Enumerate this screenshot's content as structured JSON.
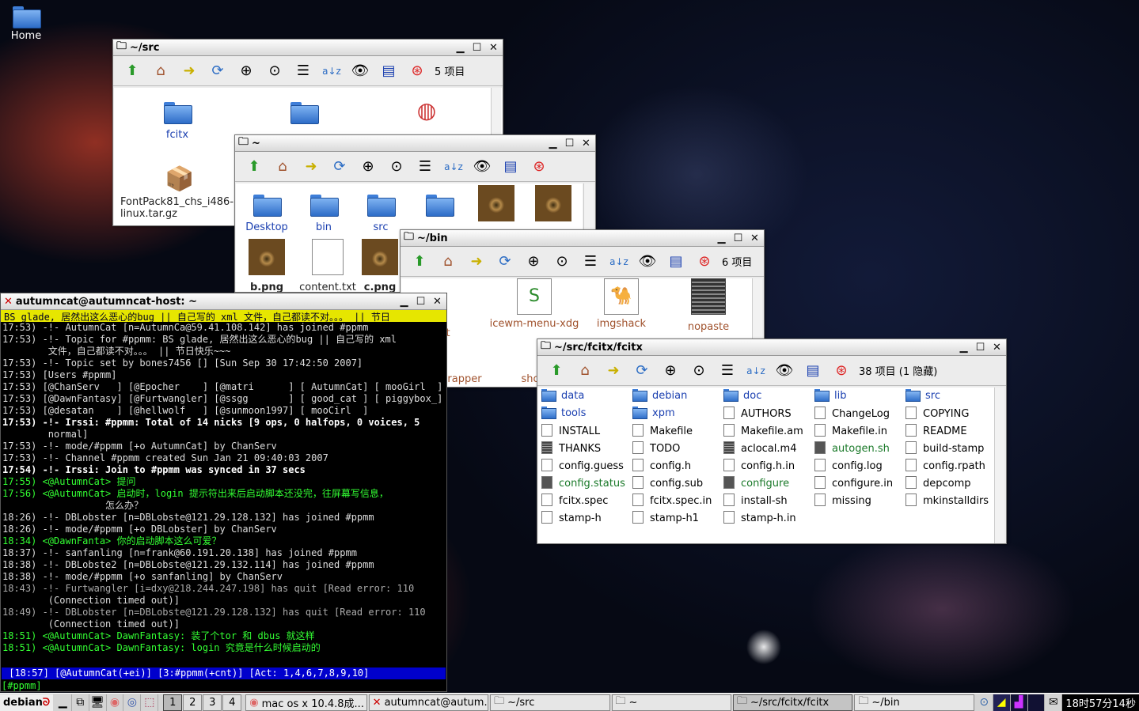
{
  "desktop": {
    "home_label": "Home"
  },
  "win_src": {
    "title": "~/src",
    "count": "5 项目",
    "items": [
      "fcitx",
      "FontPack81_chs_i486-linux.tar.gz"
    ]
  },
  "win_home": {
    "title": "~",
    "items": [
      "Desktop",
      "bin",
      "src",
      "b.png",
      "content.txt",
      "c.png"
    ]
  },
  "win_bin": {
    "title": "~/bin",
    "count": "6 项目",
    "items": [
      "Get",
      "icewm-menu-xdg",
      "imgshack",
      "nopaste",
      "rapper",
      "sho"
    ]
  },
  "win_fcitx": {
    "title": "~/src/fcitx/fcitx",
    "count": "38 项目 (1 隐藏)",
    "files": [
      "data",
      "debian",
      "doc",
      "lib",
      "src",
      "tools",
      "xpm",
      "AUTHORS",
      "ChangeLog",
      "COPYING",
      "INSTALL",
      "Makefile",
      "Makefile.am",
      "Makefile.in",
      "README",
      "THANKS",
      "TODO",
      "aclocal.m4",
      "autogen.sh",
      "build-stamp",
      "config.guess",
      "config.h",
      "config.h.in",
      "config.log",
      "config.rpath",
      "config.status",
      "config.sub",
      "configure",
      "configure.in",
      "depcomp",
      "fcitx.spec",
      "fcitx.spec.in",
      "install-sh",
      "missing",
      "mkinstalldirs",
      "stamp-h",
      "stamp-h1",
      "stamp-h.in"
    ]
  },
  "terminal": {
    "title": "autumncat@autumncat-host: ~",
    "topic": "BS glade, 居然出这么恶心的bug || 自己写的 xml 文件，自己都读不对。。。 || 节日",
    "lines": [
      "17:53) -!- AutumnCat [n=AutumnCa@59.41.108.142] has joined #ppmm",
      "17:53) -!- Topic for #ppmm: BS glade, 居然出这么恶心的bug || 自己写的 xml",
      "        文件，自己都读不对。。。 || 节日快乐~~~",
      "17:53) -!- Topic set by bones7456 [] [Sun Sep 30 17:42:50 2007]",
      "17:53) [Users #ppmm]",
      "17:53) [@ChanServ   ] [@Epocher    ] [@matri      ] [ AutumnCat] [ mooGirl  ]",
      "17:53) [@DawnFantasy] [@Furtwangler] [@ssgg       ] [ good_cat ] [ piggybox_]",
      "17:53) [@desatan    ] [@hellwolf   ] [@sunmoon1997] [ mooCirl  ]",
      "17:53) -!- Irssi: #ppmm: Total of 14 nicks [9 ops, 0 halfops, 0 voices, 5",
      "        normal]",
      "17:53) -!- mode/#ppmm [+o AutumnCat] by ChanServ",
      "17:53) -!- Channel #ppmm created Sun Jan 21 09:40:03 2007",
      "17:54) -!- Irssi: Join to #ppmm was synced in 37 secs",
      "17:55) <@AutumnCat> 提问",
      "17:56) <@AutumnCat> 启动时，login 提示符出来后启动脚本还没完，往屏幕写信息，",
      "                  怎么办？",
      "18:26) -!- DBLobster [n=DBLobste@121.29.128.132] has joined #ppmm",
      "18:26) -!- mode/#ppmm [+o DBLobster] by ChanServ",
      "18:34) <@DawnFanta> 你的启动脚本这么可爱？",
      "18:37) -!- sanfanling [n=frank@60.191.20.138] has joined #ppmm",
      "18:38) -!- DBLobste2 [n=DBLobste@121.29.132.114] has joined #ppmm",
      "18:38) -!- mode/#ppmm [+o sanfanling] by ChanServ",
      "18:43) -!- Furtwangler [i=dxy@218.244.247.198] has quit [Read error: 110",
      "        (Connection timed out)]",
      "18:49) -!- DBLobster [n=DBLobste@121.29.128.132] has quit [Read error: 110",
      "        (Connection timed out)]",
      "18:51) <@AutumnCat> DawnFantasy: 装了个tor 和 dbus 就这样",
      "18:51) <@AutumnCat> DawnFantasy: login 究竟是什么时候启动的"
    ],
    "status": " [18:57] [@AutumnCat(+ei)] [3:#ppmm(+cnt)] [Act: 1,4,6,7,8,9,10]",
    "prompt": "[#ppmm] "
  },
  "taskbar": {
    "start": "debian",
    "workspaces": [
      "1",
      "2",
      "3",
      "4"
    ],
    "tasks": [
      "mac os x 10.4.8成...",
      "autumncat@autum...",
      "~/src",
      "~",
      "~/src/fcitx/fcitx",
      "~/bin"
    ],
    "clock": "18时57分14秒"
  }
}
